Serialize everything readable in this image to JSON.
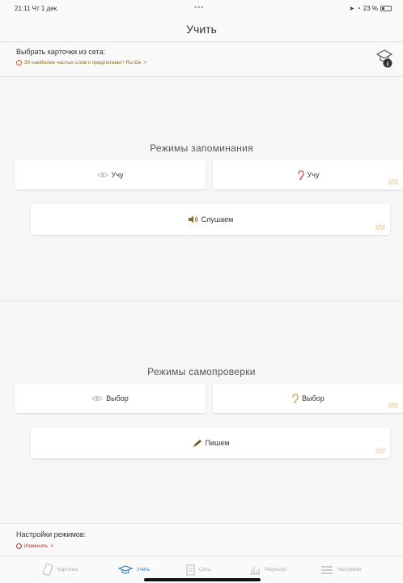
{
  "status_bar": {
    "time_date": "21:11  Чт 1 дек.",
    "dots": "•••",
    "battery": "23 %"
  },
  "nav": {
    "title": "Учить"
  },
  "set_selector": {
    "title": "Выбрать карточки из сета:",
    "current_set": "30 наиболее частых слов с предлогами • Ru-De"
  },
  "memorize_section": {
    "title": "Режимы запоминания",
    "modes": [
      {
        "label": "Учу",
        "icon": "eye-icon"
      },
      {
        "label": "Учу",
        "icon": "ear-icon"
      },
      {
        "label": "Слушаем",
        "icon": "speaker-icon"
      }
    ]
  },
  "selftest_section": {
    "title": "Режимы самопроверки",
    "modes": [
      {
        "label": "Выбор",
        "icon": "eye-icon"
      },
      {
        "label": "Выбор",
        "icon": "ear-icon"
      },
      {
        "label": "Пишем",
        "icon": "pencil-icon"
      }
    ]
  },
  "mode_settings": {
    "title": "Настройки режимов:",
    "change_link": "Изменить"
  },
  "tabs": [
    {
      "label": "Карточка",
      "icon": "card-icon",
      "active": false
    },
    {
      "label": "Учить",
      "icon": "graduation-cap-icon",
      "active": true
    },
    {
      "label": "Сеты",
      "icon": "sets-icon",
      "active": false
    },
    {
      "label": "Результат",
      "icon": "results-icon",
      "active": false
    },
    {
      "label": "Настройки",
      "icon": "settings-icon",
      "active": false
    }
  ],
  "colors": {
    "accent": "#2a7db8",
    "link_gold": "#8a6d1f",
    "crown": "#e0cfa0"
  }
}
